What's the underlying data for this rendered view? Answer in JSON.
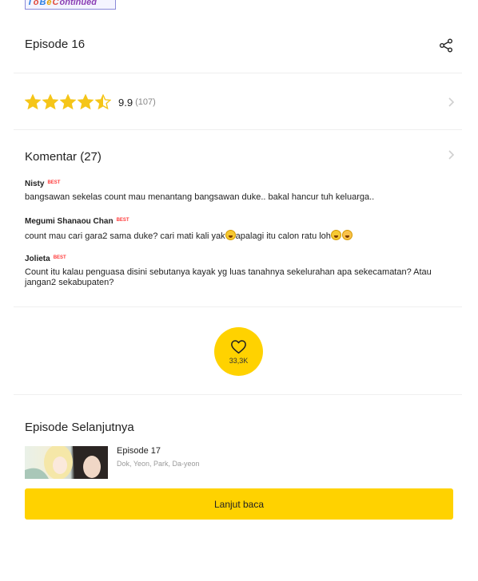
{
  "header": {
    "logo_text": "ToBeContinued"
  },
  "episode": {
    "title": "Episode 16"
  },
  "rating": {
    "stars": 4.5,
    "value": "9.9",
    "count": "(107)"
  },
  "comments": {
    "title": "Komentar (27)",
    "best_badge": "BEST",
    "items": [
      {
        "user": "Nisty",
        "text": "bangsawan sekelas count mau menantang bangsawan duke.. bakal hancur tuh keluarga.."
      },
      {
        "user": "Megumi Shanaou Chan",
        "text_before": "count mau cari gara2 sama duke? cari mati kali yak",
        "text_middle": "apalagi itu calon ratu loh",
        "text_after": ""
      },
      {
        "user": "Jolieta",
        "text": "Count itu kalau penguasa disini sebutanya kayak yg luas tanahnya sekelurahan apa sekecamatan? Atau jangan2 sekabupaten?"
      }
    ]
  },
  "like": {
    "count": "33,3K"
  },
  "next": {
    "section_title": "Episode Selanjutnya",
    "episode": "Episode 17",
    "authors": "Dok, Yeon, Park, Da-yeon",
    "read_button": "Lanjut baca"
  },
  "colors": {
    "accent": "#ffd200",
    "star": "#f5c518",
    "best": "#ff3b3b"
  }
}
